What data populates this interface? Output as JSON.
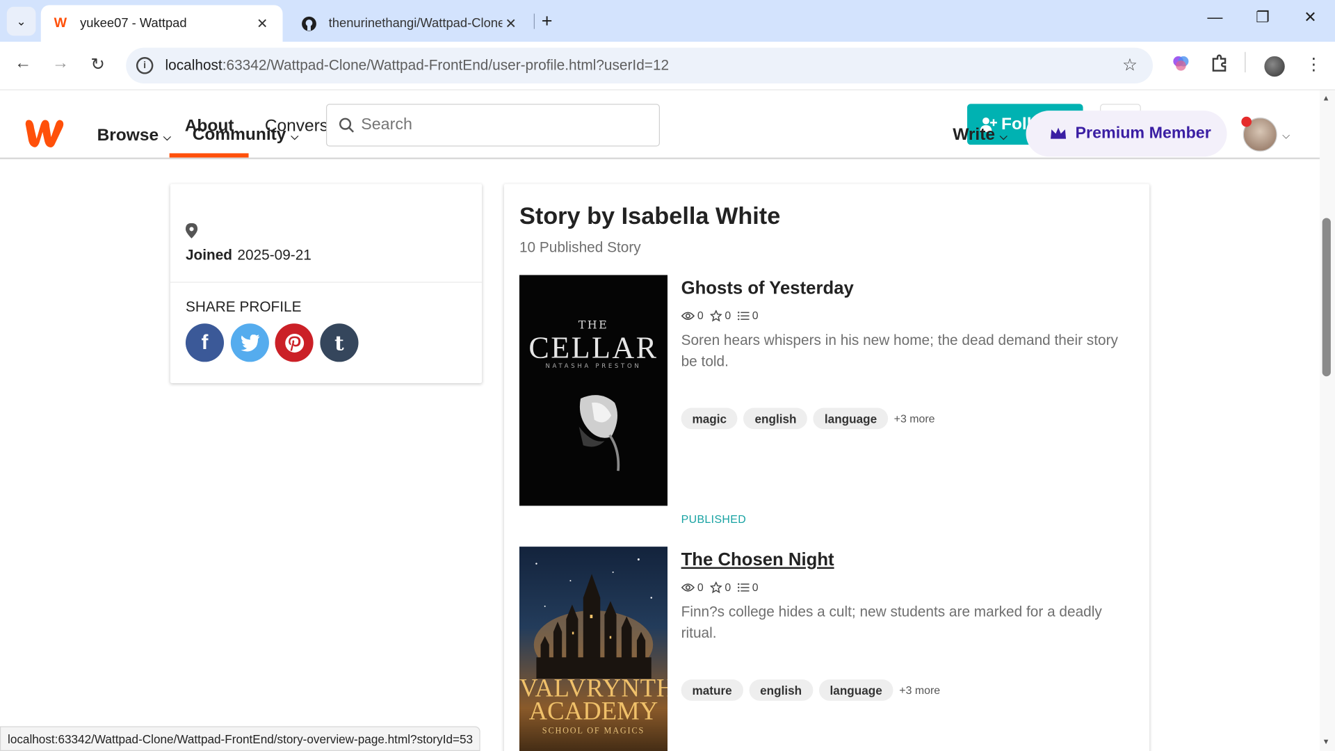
{
  "browser": {
    "tabs": [
      {
        "title": "yukee07 - Wattpad",
        "active": true
      },
      {
        "title": "thenurinethangi/Wattpad-Clone",
        "active": false
      }
    ],
    "url_host": "localhost",
    "url_rest": ":63342/Wattpad-Clone/Wattpad-FrontEnd/user-profile.html?userId=12",
    "status_url": "localhost:63342/Wattpad-Clone/Wattpad-FrontEnd/story-overview-page.html?storyId=53"
  },
  "header": {
    "nav": {
      "browse": "Browse",
      "community": "Community",
      "about": "About",
      "conversations": "Convers",
      "write": "Write"
    },
    "search_placeholder": "Search",
    "follow_label": "Foll",
    "premium_label": "Premium Member"
  },
  "profile": {
    "joined_label": "Joined",
    "joined_date": "2025-09-21",
    "share_title": "SHARE PROFILE"
  },
  "stories_panel": {
    "title": "Story by Isabella White",
    "subtitle": "10 Published Story",
    "stories": [
      {
        "title": "Ghosts of Yesterday",
        "views": "0",
        "votes": "0",
        "parts": "0",
        "description": "Soren hears whispers in his new home; the dead demand their story be told.",
        "tags": [
          "magic",
          "english",
          "language"
        ],
        "more_tags": "+3 more",
        "status": "PUBLISHED",
        "cover": {
          "top": "THE",
          "title": "CELLAR",
          "author": "NATASHA PRESTON"
        }
      },
      {
        "title": "The Chosen Night",
        "views": "0",
        "votes": "0",
        "parts": "0",
        "description": "Finn?s college hides a cult; new students are marked for a deadly ritual.",
        "tags": [
          "mature",
          "english",
          "language"
        ],
        "more_tags": "+3 more",
        "cover": {
          "line1": "VALVRYNTH",
          "line2": "ACADEMY",
          "line3": "SCHOOL OF MAGICS"
        }
      }
    ]
  },
  "colors": {
    "brand_orange": "#ff500a",
    "teal": "#00b2b2",
    "premium_purple": "#3a1ea3"
  }
}
